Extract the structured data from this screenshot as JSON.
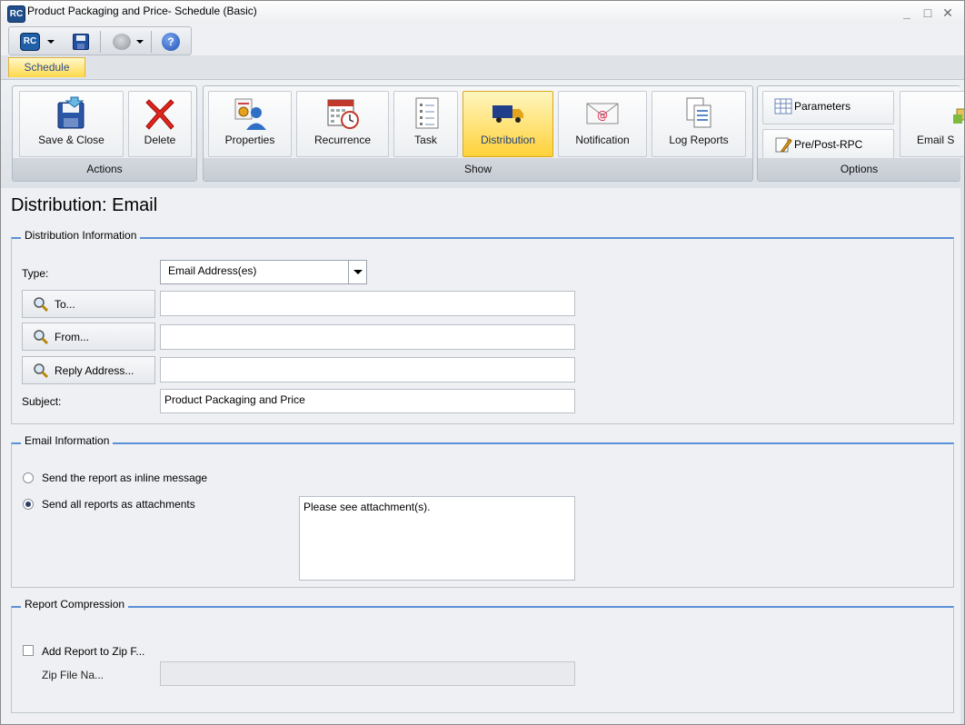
{
  "window": {
    "title": "Product Packaging and Price- Schedule (Basic)",
    "app_badge": "RC",
    "controls": {
      "minimize": "_",
      "maximize": "□",
      "close": "✕"
    }
  },
  "qat": {
    "rc_label": "RC",
    "help_glyph": "?"
  },
  "ribbon": {
    "active_tab": "Schedule",
    "groups": {
      "actions": {
        "label": "Actions",
        "save_close": "Save & Close",
        "delete": "Delete"
      },
      "show": {
        "label": "Show",
        "properties": "Properties",
        "recurrence": "Recurrence",
        "task": "Task",
        "distribution": "Distribution",
        "notification": "Notification",
        "log_reports": "Log Reports"
      },
      "options": {
        "label": "Options",
        "parameters": "Parameters",
        "pre_post_rpc": "Pre/Post-RPC",
        "email_s": "Email S"
      }
    }
  },
  "page": {
    "title": "Distribution: Email"
  },
  "distribution_info": {
    "legend": "Distribution Information",
    "type_label": "Type:",
    "type_value": "Email Address(es)",
    "to_label": "To...",
    "to_value": "",
    "from_label": "From...",
    "from_value": "",
    "reply_label": "Reply Address...",
    "reply_value": "",
    "subject_label": "Subject:",
    "subject_value": "Product Packaging and Price"
  },
  "email_info": {
    "legend": "Email Information",
    "option_inline": "Send the report as inline message",
    "option_attachments": "Send all reports as attachments",
    "selected": "attachments",
    "message": "Please see attachment(s)."
  },
  "compression": {
    "legend": "Report Compression",
    "zip_checkbox_label": "Add Report to Zip F...",
    "zip_checked": false,
    "zip_name_label": "Zip File Na...",
    "zip_name_value": ""
  },
  "colors": {
    "accent": "#5b8fd6",
    "active_tab": "#ffd94a"
  }
}
